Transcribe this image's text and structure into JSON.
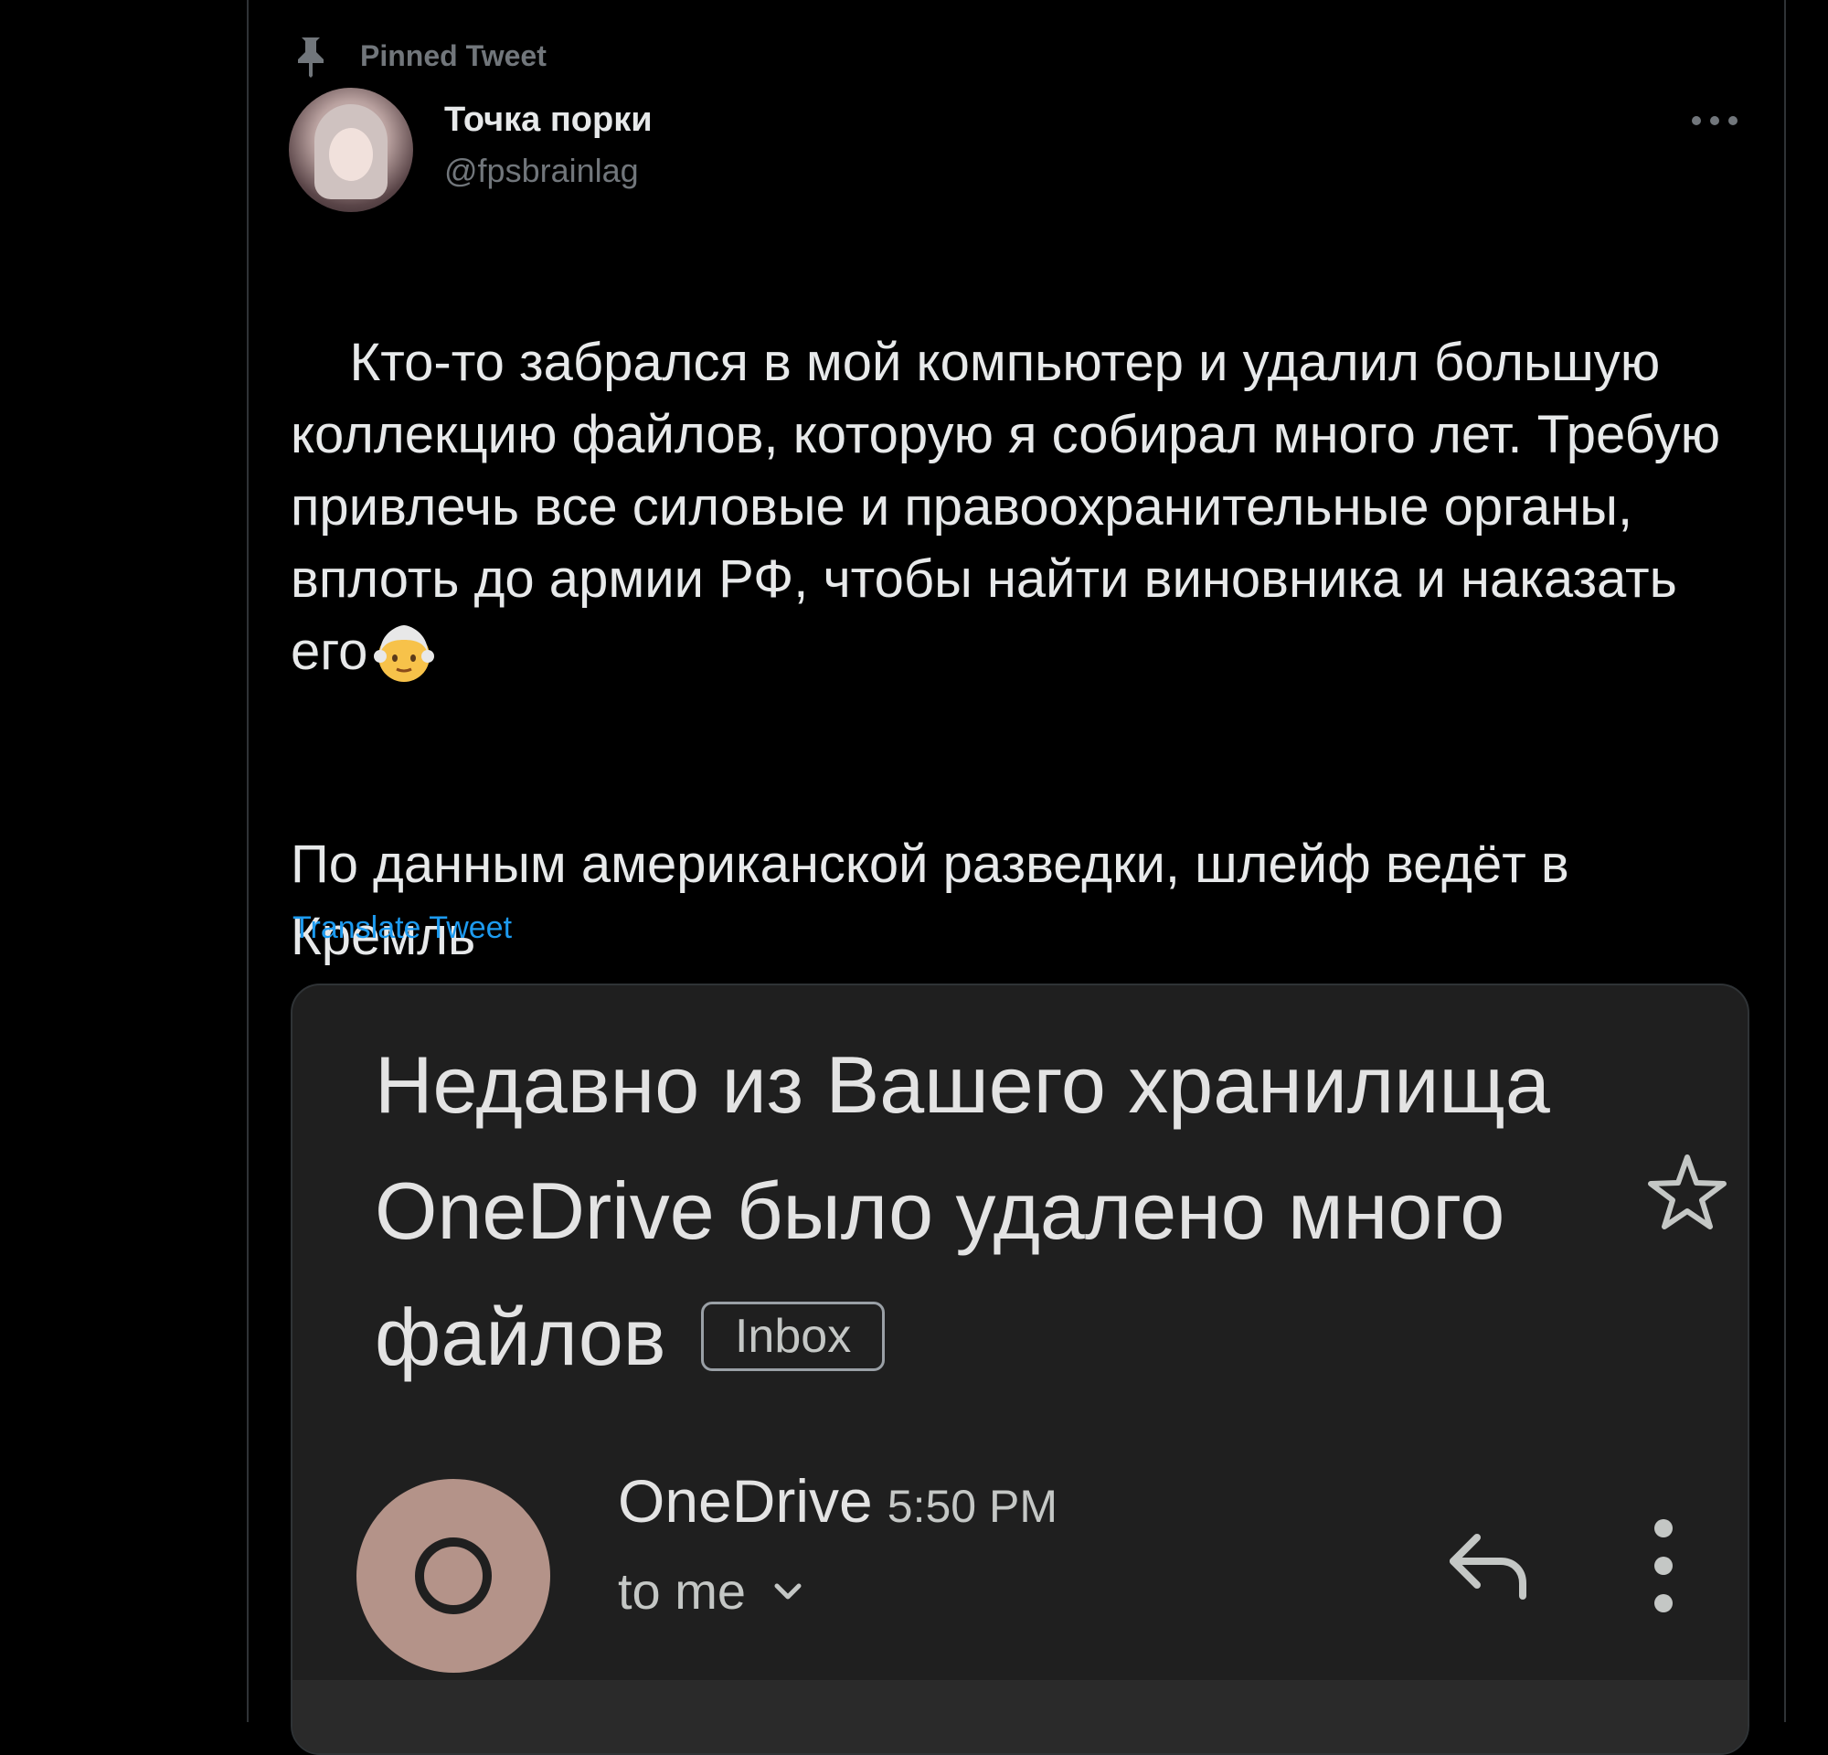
{
  "pinned_label": "Pinned Tweet",
  "author": {
    "display_name": "Точка порки",
    "handle": "@fpsbrainlag"
  },
  "tweet": {
    "paragraph1": "Кто-то забрался в мой компьютер и удалил большую коллекцию файлов, которую я собирал много лет. Требую привлечь все силовые и правоохранительные органы, вплоть до армии РФ, чтобы найти виновника и наказать его",
    "paragraph2": "По данным американской разведки, шлейф ведёт в Кремль",
    "translate_label": "Translate Tweet"
  },
  "email": {
    "subject": "Недавно из Вашего хранилища OneDrive было удалено много файлов",
    "label": "Inbox",
    "sender": "OneDrive",
    "time": "5:50 PM",
    "recipient": "to me"
  },
  "icons": {
    "pin": "pin-icon",
    "more": "more-horizontal-icon",
    "emoji": "older-person-emoji",
    "star": "star-icon",
    "reply": "reply-icon",
    "kebab": "more-vertical-icon",
    "chevron": "chevron-down-icon"
  },
  "colors": {
    "background": "#000000",
    "accent": "#1d9bf0",
    "muted": "#71767b",
    "text": "#e7e9ea",
    "email_bg": "#1f1f1f",
    "sender_avatar": "#b49389"
  }
}
